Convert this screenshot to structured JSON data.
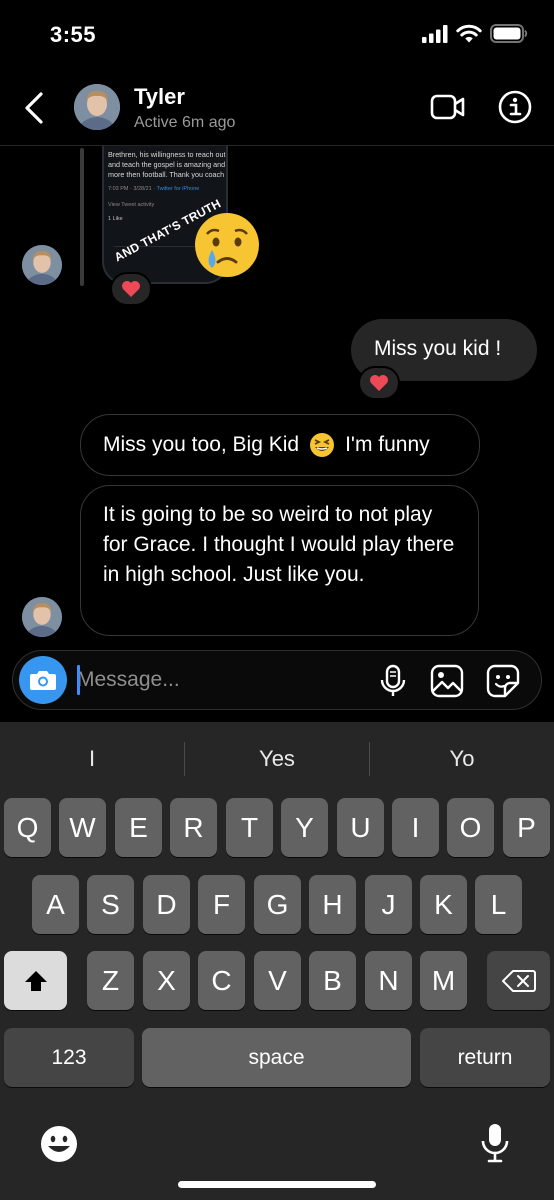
{
  "status_bar": {
    "time": "3:55",
    "icons": [
      "signal-icon",
      "wifi-icon",
      "battery-icon"
    ]
  },
  "header": {
    "name": "Tyler",
    "status": "Active 6m ago",
    "icons": [
      "back-arrow-icon",
      "video-call-icon",
      "info-icon"
    ]
  },
  "shared_post": {
    "text": "Brethren, his willingness to reach out and teach the gospel is amazing and more then football. Thank you coach",
    "time": "7:03 PM · 3/28/21 · ",
    "source": "Twitter for iPhone",
    "activity": "View Tweet activity",
    "likes": "1 Like",
    "sticker_text": "AND THAT'S TRUTH"
  },
  "messages": [
    {
      "direction": "incoming",
      "type": "shared_post",
      "reaction": "red-heart"
    },
    {
      "direction": "outgoing",
      "text": "Miss you kid !",
      "reaction": "red-heart"
    },
    {
      "direction": "incoming",
      "text_before": "Miss you too, Big Kid",
      "emoji": "grinning-squinting-face",
      "text_after": "I'm funny"
    },
    {
      "direction": "incoming",
      "text": "It is going to be so weird to not play for Grace. I thought I would play there in high school. Just like you."
    }
  ],
  "composer": {
    "placeholder": "Message...",
    "value": "",
    "icons": [
      "camera-icon",
      "microphone-icon",
      "gallery-icon",
      "sticker-icon"
    ]
  },
  "keyboard": {
    "suggestions": [
      "I",
      "Yes",
      "Yo"
    ],
    "row1": [
      "Q",
      "W",
      "E",
      "R",
      "T",
      "Y",
      "U",
      "I",
      "O",
      "P"
    ],
    "row2": [
      "A",
      "S",
      "D",
      "F",
      "G",
      "H",
      "J",
      "K",
      "L"
    ],
    "row3": [
      "Z",
      "X",
      "C",
      "V",
      "B",
      "N",
      "M"
    ],
    "numbers_key": "123",
    "space_key": "space",
    "return_key": "return",
    "icons": [
      "shift-icon",
      "delete-icon",
      "emoji-icon",
      "dictation-icon"
    ]
  },
  "colors": {
    "background": "#000000",
    "outgoing_bubble": "#262626",
    "accent_blue": "#3797f0",
    "heart_red": "#ed4956",
    "keyboard_bg": "#262626",
    "key_bg": "#626262"
  }
}
